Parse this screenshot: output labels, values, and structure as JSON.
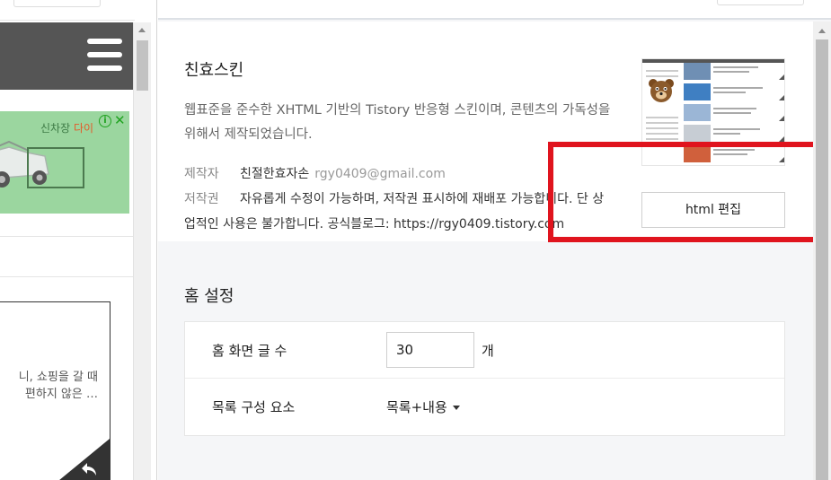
{
  "preview": {
    "ad": {
      "text_prefix": "신차장 ",
      "text_highlight": "다이",
      "info_glyph": "i",
      "close_glyph": "✕"
    },
    "post": {
      "line1": "니, 쇼핑을 갈 때",
      "line2": "편하지 않은 …"
    }
  },
  "skin": {
    "name": "친효스킨",
    "description": "웹표준을 준수한 XHTML 기반의 Tistory 반응형 스킨이며, 콘텐츠의 가독성을 위해서 제작되었습니다.",
    "author_label": "제작자",
    "author_name": "친절한효자손",
    "author_email": "rgy0409@gmail.com",
    "copyright_label": "저작권",
    "copyright_text_1": "자유롭게 수정이 가능하며, 저작권 표시하에 재배포 가능합니다. 단 상",
    "copyright_text_2": "업적인 사용은 불가합니다. 공식블로그: https://rgy0409.tistory.com",
    "edit_button": "html 편집"
  },
  "home": {
    "title": "홈 설정",
    "post_count_label": "홈 화면 글 수",
    "post_count_value": "30",
    "post_count_unit": "개",
    "list_label": "목록 구성 요소",
    "list_value": "목록+내용"
  },
  "colors": {
    "highlight": "#e0141e",
    "ad_bg": "#9bd69f",
    "header_bg": "#555555"
  },
  "icons": {
    "menu": "hamburger-icon",
    "reply": "reply-icon",
    "dropdown": "caret-down-icon"
  }
}
